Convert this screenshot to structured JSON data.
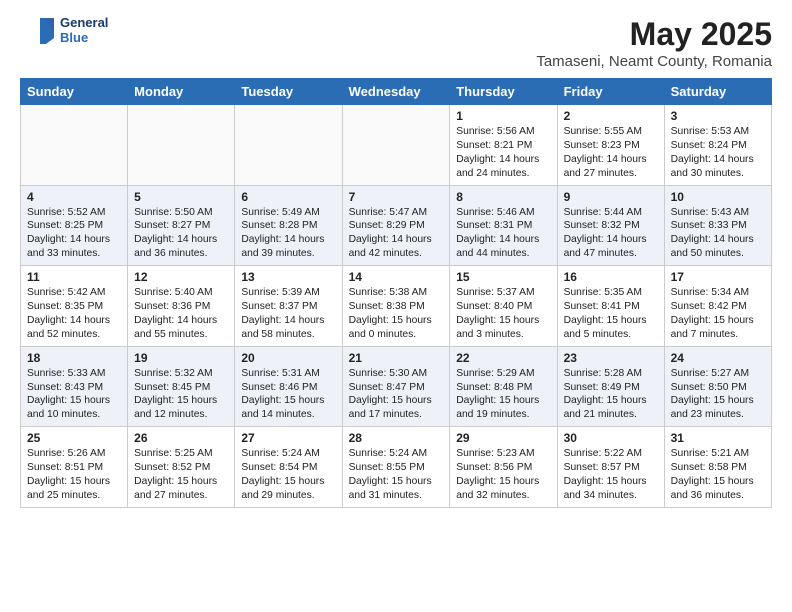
{
  "header": {
    "logo_line1": "General",
    "logo_line2": "Blue",
    "month": "May 2025",
    "location": "Tamaseni, Neamt County, Romania"
  },
  "days_of_week": [
    "Sunday",
    "Monday",
    "Tuesday",
    "Wednesday",
    "Thursday",
    "Friday",
    "Saturday"
  ],
  "weeks": [
    [
      {
        "day": "",
        "content": ""
      },
      {
        "day": "",
        "content": ""
      },
      {
        "day": "",
        "content": ""
      },
      {
        "day": "",
        "content": ""
      },
      {
        "day": "1",
        "content": "Sunrise: 5:56 AM\nSunset: 8:21 PM\nDaylight: 14 hours\nand 24 minutes."
      },
      {
        "day": "2",
        "content": "Sunrise: 5:55 AM\nSunset: 8:23 PM\nDaylight: 14 hours\nand 27 minutes."
      },
      {
        "day": "3",
        "content": "Sunrise: 5:53 AM\nSunset: 8:24 PM\nDaylight: 14 hours\nand 30 minutes."
      }
    ],
    [
      {
        "day": "4",
        "content": "Sunrise: 5:52 AM\nSunset: 8:25 PM\nDaylight: 14 hours\nand 33 minutes."
      },
      {
        "day": "5",
        "content": "Sunrise: 5:50 AM\nSunset: 8:27 PM\nDaylight: 14 hours\nand 36 minutes."
      },
      {
        "day": "6",
        "content": "Sunrise: 5:49 AM\nSunset: 8:28 PM\nDaylight: 14 hours\nand 39 minutes."
      },
      {
        "day": "7",
        "content": "Sunrise: 5:47 AM\nSunset: 8:29 PM\nDaylight: 14 hours\nand 42 minutes."
      },
      {
        "day": "8",
        "content": "Sunrise: 5:46 AM\nSunset: 8:31 PM\nDaylight: 14 hours\nand 44 minutes."
      },
      {
        "day": "9",
        "content": "Sunrise: 5:44 AM\nSunset: 8:32 PM\nDaylight: 14 hours\nand 47 minutes."
      },
      {
        "day": "10",
        "content": "Sunrise: 5:43 AM\nSunset: 8:33 PM\nDaylight: 14 hours\nand 50 minutes."
      }
    ],
    [
      {
        "day": "11",
        "content": "Sunrise: 5:42 AM\nSunset: 8:35 PM\nDaylight: 14 hours\nand 52 minutes."
      },
      {
        "day": "12",
        "content": "Sunrise: 5:40 AM\nSunset: 8:36 PM\nDaylight: 14 hours\nand 55 minutes."
      },
      {
        "day": "13",
        "content": "Sunrise: 5:39 AM\nSunset: 8:37 PM\nDaylight: 14 hours\nand 58 minutes."
      },
      {
        "day": "14",
        "content": "Sunrise: 5:38 AM\nSunset: 8:38 PM\nDaylight: 15 hours\nand 0 minutes."
      },
      {
        "day": "15",
        "content": "Sunrise: 5:37 AM\nSunset: 8:40 PM\nDaylight: 15 hours\nand 3 minutes."
      },
      {
        "day": "16",
        "content": "Sunrise: 5:35 AM\nSunset: 8:41 PM\nDaylight: 15 hours\nand 5 minutes."
      },
      {
        "day": "17",
        "content": "Sunrise: 5:34 AM\nSunset: 8:42 PM\nDaylight: 15 hours\nand 7 minutes."
      }
    ],
    [
      {
        "day": "18",
        "content": "Sunrise: 5:33 AM\nSunset: 8:43 PM\nDaylight: 15 hours\nand 10 minutes."
      },
      {
        "day": "19",
        "content": "Sunrise: 5:32 AM\nSunset: 8:45 PM\nDaylight: 15 hours\nand 12 minutes."
      },
      {
        "day": "20",
        "content": "Sunrise: 5:31 AM\nSunset: 8:46 PM\nDaylight: 15 hours\nand 14 minutes."
      },
      {
        "day": "21",
        "content": "Sunrise: 5:30 AM\nSunset: 8:47 PM\nDaylight: 15 hours\nand 17 minutes."
      },
      {
        "day": "22",
        "content": "Sunrise: 5:29 AM\nSunset: 8:48 PM\nDaylight: 15 hours\nand 19 minutes."
      },
      {
        "day": "23",
        "content": "Sunrise: 5:28 AM\nSunset: 8:49 PM\nDaylight: 15 hours\nand 21 minutes."
      },
      {
        "day": "24",
        "content": "Sunrise: 5:27 AM\nSunset: 8:50 PM\nDaylight: 15 hours\nand 23 minutes."
      }
    ],
    [
      {
        "day": "25",
        "content": "Sunrise: 5:26 AM\nSunset: 8:51 PM\nDaylight: 15 hours\nand 25 minutes."
      },
      {
        "day": "26",
        "content": "Sunrise: 5:25 AM\nSunset: 8:52 PM\nDaylight: 15 hours\nand 27 minutes."
      },
      {
        "day": "27",
        "content": "Sunrise: 5:24 AM\nSunset: 8:54 PM\nDaylight: 15 hours\nand 29 minutes."
      },
      {
        "day": "28",
        "content": "Sunrise: 5:24 AM\nSunset: 8:55 PM\nDaylight: 15 hours\nand 31 minutes."
      },
      {
        "day": "29",
        "content": "Sunrise: 5:23 AM\nSunset: 8:56 PM\nDaylight: 15 hours\nand 32 minutes."
      },
      {
        "day": "30",
        "content": "Sunrise: 5:22 AM\nSunset: 8:57 PM\nDaylight: 15 hours\nand 34 minutes."
      },
      {
        "day": "31",
        "content": "Sunrise: 5:21 AM\nSunset: 8:58 PM\nDaylight: 15 hours\nand 36 minutes."
      }
    ]
  ]
}
